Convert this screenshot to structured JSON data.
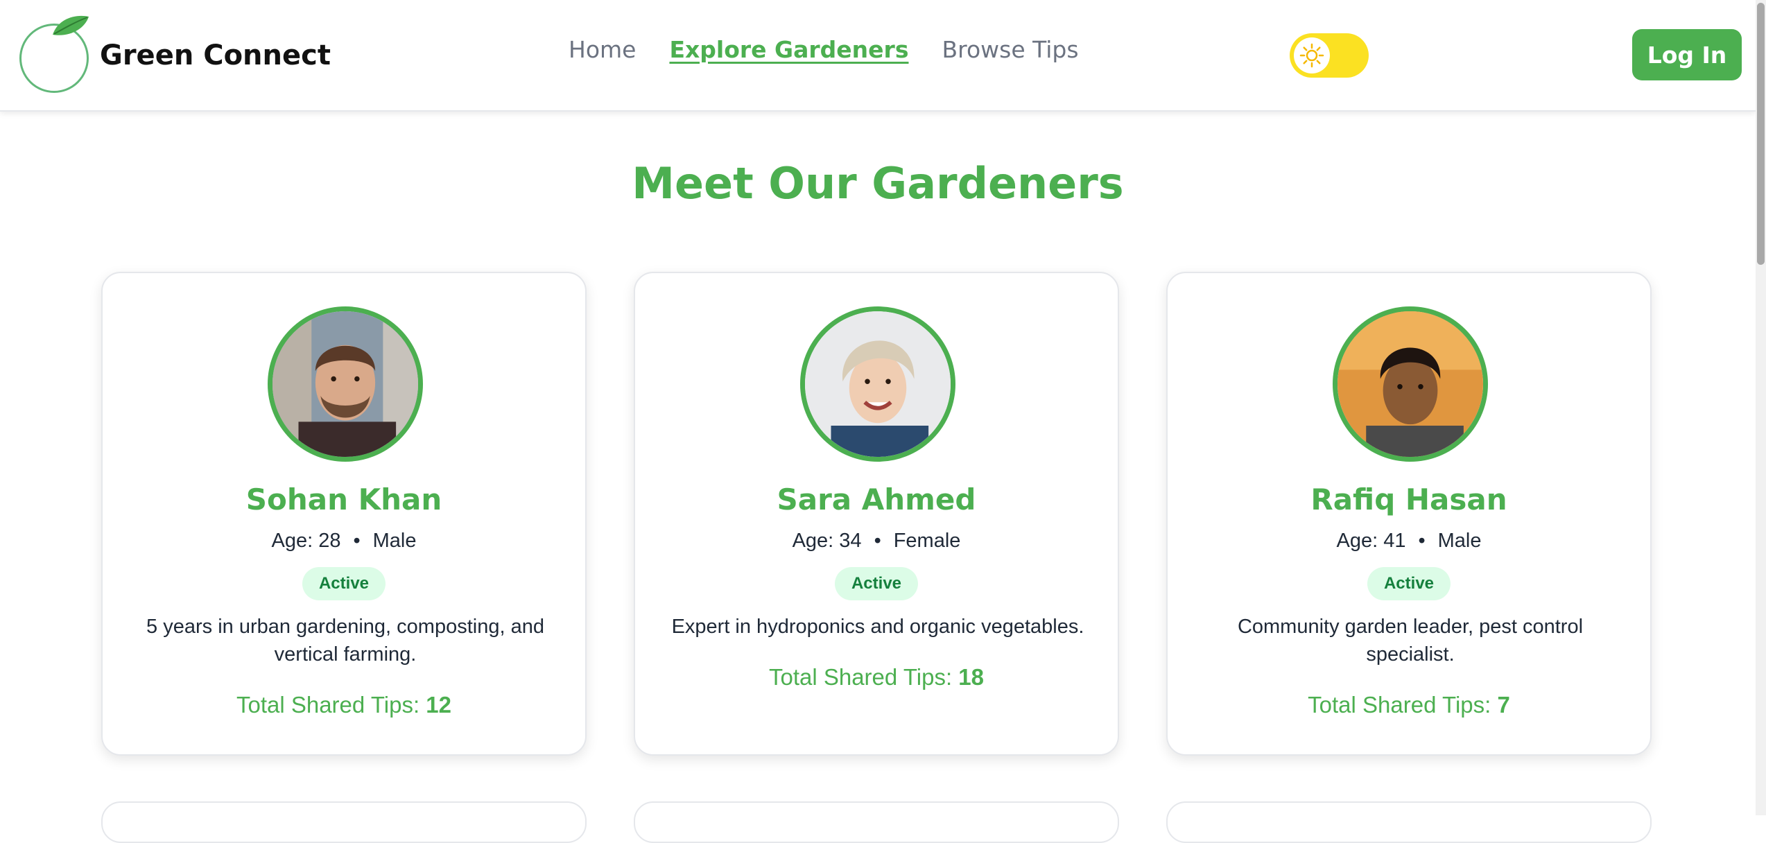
{
  "app": {
    "brand": "Green Connect"
  },
  "nav": {
    "links": [
      {
        "label": "Home",
        "active": false
      },
      {
        "label": "Explore Gardeners",
        "active": true
      },
      {
        "label": "Browse Tips",
        "active": false
      }
    ],
    "theme_toggle_icon": "sun-icon",
    "login_label": "Log In"
  },
  "colors": {
    "accent": "#4caf50",
    "toggle": "#fbe122",
    "badge_bg": "#dcfce7",
    "badge_text": "#15803d"
  },
  "page": {
    "title": "Meet Our Gardeners"
  },
  "gardeners": [
    {
      "name": "Sohan Khan",
      "age_text": "Age: 28",
      "gender": "Male",
      "status": "Active",
      "description": "5 years in urban gardening, composting, and vertical farming.",
      "tips_label": "Total Shared Tips:",
      "tips_count": "12"
    },
    {
      "name": "Sara Ahmed",
      "age_text": "Age: 34",
      "gender": "Female",
      "status": "Active",
      "description": "Expert in hydroponics and organic vegetables.",
      "tips_label": "Total Shared Tips:",
      "tips_count": "18"
    },
    {
      "name": "Rafiq Hasan",
      "age_text": "Age: 41",
      "gender": "Male",
      "status": "Active",
      "description": "Community garden leader, pest control specialist.",
      "tips_label": "Total Shared Tips:",
      "tips_count": "7"
    }
  ]
}
